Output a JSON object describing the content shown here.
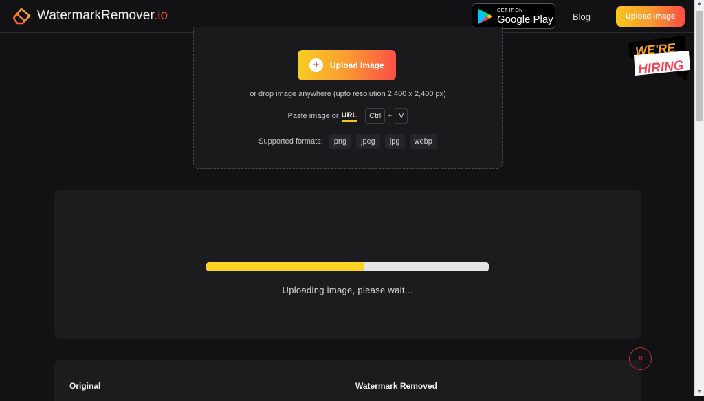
{
  "header": {
    "logo_text": "WatermarkRemover",
    "logo_tld": ".io",
    "google_play_small": "GET IT ON",
    "google_play_big": "Google Play",
    "blog_label": "Blog",
    "upload_label": "Upload Image",
    "hiring_line1": "WE'RE",
    "hiring_line2": "HIRING"
  },
  "dropzone": {
    "upload_label": "Upload Image",
    "drop_text": "or drop image anywhere (upto resolution 2,400 x 2,400 px)",
    "paste_text": "Paste image or",
    "url_label": "URL",
    "key_ctrl": "Ctrl",
    "key_plus": "+",
    "key_v": "V",
    "formats_label": "Supported formats:",
    "formats": [
      "png",
      "jpeg",
      "jpg",
      "webp"
    ]
  },
  "progress": {
    "percent": 56,
    "status_text": "Uploading image, please wait..."
  },
  "result": {
    "original_label": "Original",
    "removed_label": "Watermark Removed",
    "close_icon": "×"
  }
}
